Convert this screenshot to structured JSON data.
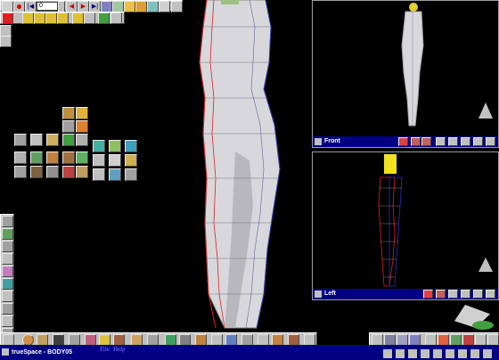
{
  "app_title": "trueSpace - BODY05",
  "counter_value": "0",
  "menu": {
    "file": "File",
    "help": "Help"
  },
  "viewports": {
    "front": {
      "label": "Front"
    },
    "left": {
      "label": "Left"
    }
  },
  "colors": {
    "background": "#000000",
    "toolbar": "#c0c0c0",
    "titlebar": "#000080",
    "wire_red": "#e02020",
    "wire_blue": "#3030c0",
    "model_fill": "#d8d8dc",
    "head_yellow": "#f0e020"
  },
  "icons": {
    "top_toolbar": [
      "window-icon",
      "record-icon",
      "prev-frame-icon",
      "first-frame-icon",
      "play-icon",
      "next-frame-icon",
      "last-frame-icon",
      "table-icon",
      "cube-icon",
      "arrow-icon",
      "lasso-icon",
      "sphere-icon",
      "pointer-icon"
    ],
    "bottom_toolbar": [
      "pointer-icon",
      "sphere-icon",
      "material-icon",
      "sun-icon",
      "cylinder-icon",
      "torus-icon",
      "camera-icon",
      "texture-icon",
      "mesh-icon",
      "paint-icon",
      "deform-icon",
      "grid-icon",
      "render-icon",
      "face-icon",
      "lamp-icon",
      "fog-icon"
    ]
  }
}
